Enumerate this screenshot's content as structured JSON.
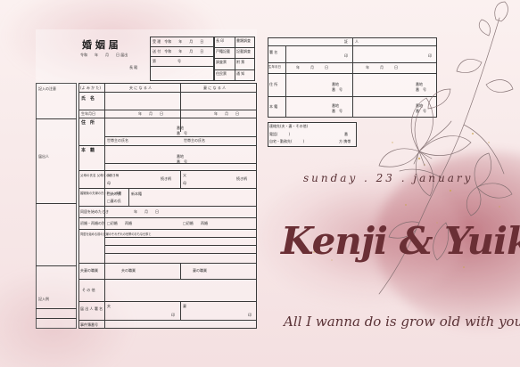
{
  "form": {
    "title": "婚 姻 届",
    "date_line": "令和　　年　　月　　日 届出",
    "recipient": "長 殿",
    "receipt_rows": [
      "受 理　令和　　年　　月　　日",
      "送 付　令和　　年　　月　　日",
      "第　　　　　　号"
    ],
    "office_rows": [
      "長 印",
      "書類調査",
      "戸籍記載",
      "記載調査",
      "調査票",
      "附 票",
      "住民票",
      "通 知"
    ],
    "col_husband": "夫 に な る 人",
    "col_wife": "妻 に な る 人",
    "furigana": "(よ み か た)",
    "rows": {
      "name": "氏　名",
      "birth": "生年月日",
      "address": "住　所",
      "honseki": "本　籍",
      "parents": "父母の氏名 父母との続き柄",
      "new_honseki": "婚姻後の夫婦の氏・新しい本籍",
      "cohabit_date": "同居を始めたとき",
      "previous": "初婚・再婚の別",
      "household": "同居を始める前の夫婦のそれぞれの世帯のおもな仕事と",
      "occupation": "夫妻の職業",
      "other": "そ の 他",
      "signature": "届 出 人 署 名",
      "contact": "事件簿番号"
    },
    "cells": {
      "year_month_day": "年　　月　　日",
      "banchi": "番地",
      "bango": "番　号",
      "household_head": "世帯主の氏名",
      "father": "父",
      "mother": "母",
      "zokugara": "続き柄",
      "husband_surname": "□夫の氏",
      "wife_surname": "□妻の氏",
      "new_honseki_label": "新本籍",
      "first_marriage": "□初婚",
      "remarriage": "再婚",
      "husband_occ": "夫の職業",
      "wife_occ": "妻の職業",
      "husband_sign": "夫",
      "wife_sign": "妻",
      "seal": "印"
    },
    "margin_notes": [
      "記入の注意",
      "鉛筆や消えやすいインキで書かないでください。",
      "届出人",
      "記入例"
    ],
    "witness_title": "証　　人",
    "witness_rows": [
      "署 名",
      "生年月日",
      "住 所",
      "本 籍"
    ],
    "witness_cells": {
      "year_month_day": "年　　　月　　　日",
      "banchi": "番地",
      "bango": "番　号",
      "seal": "印"
    },
    "contact_title": "連絡先(夫・妻・その他)",
    "contact_rows": [
      "電話(　　　)",
      "自宅・勤務先(　　　)"
    ],
    "contact_cells": [
      "番",
      "方 携帯"
    ]
  },
  "decor": {
    "date_text": "sunday . 23 . january",
    "names": "Kenji & Yuiko",
    "tagline": "All I wanna do is grow old with you",
    "accent_color": "#6e3a3e",
    "wash_color": "#c98a93",
    "gold_color": "#c9a44a"
  }
}
